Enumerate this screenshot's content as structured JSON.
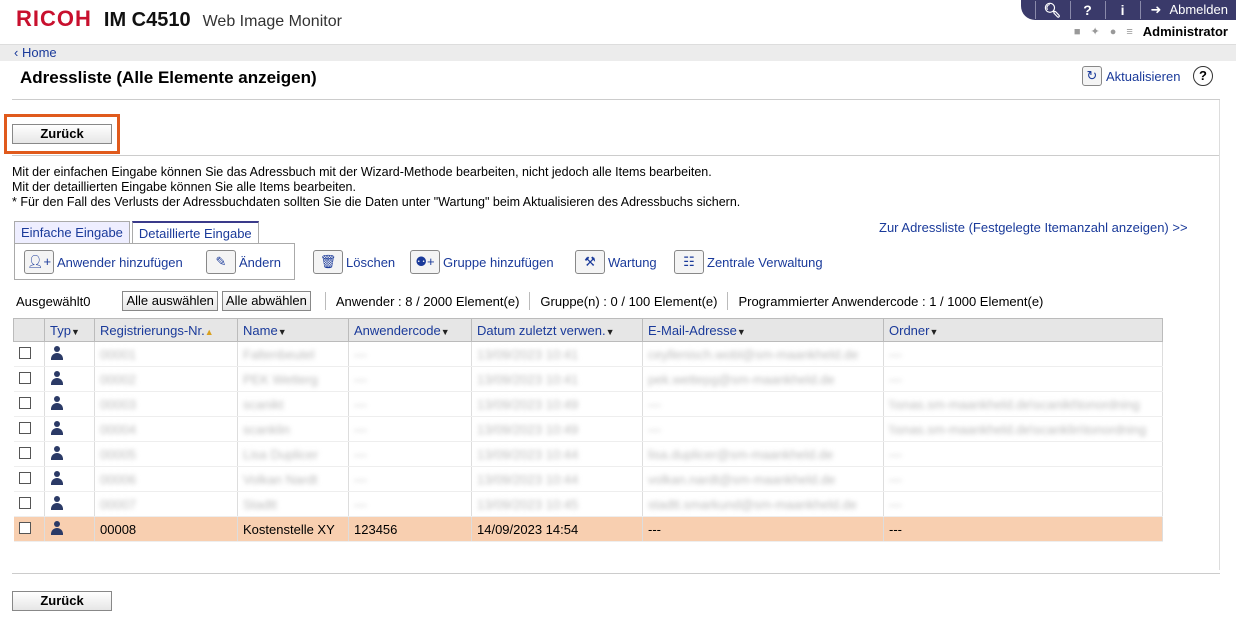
{
  "header": {
    "brand": "RICOH",
    "model": "IM C4510",
    "app": "Web Image Monitor",
    "logout": "Abmelden",
    "user": "Administrator",
    "search_icon": "search-icon",
    "help_icon": "?",
    "info_icon": "i"
  },
  "breadcrumb": {
    "home": "Home"
  },
  "page": {
    "title": "Adressliste (Alle Elemente anzeigen)",
    "refresh": "Aktualisieren",
    "back": "Zurück"
  },
  "info": {
    "line1": "Mit der einfachen Eingabe können Sie das Adressbuch mit der Wizard-Methode bearbeiten, nicht jedoch alle Items bearbeiten.",
    "line2": "Mit der detaillierten Eingabe können Sie alle Items bearbeiten.",
    "line3": "* Für den Fall des Verlusts der Adressbuchdaten sollten Sie die Daten unter \"Wartung\" beim Aktualisieren des Adressbuchs sichern."
  },
  "tabs": [
    "Einfache Eingabe",
    "Detaillierte Eingabe"
  ],
  "tools": {
    "add_user": "Anwender hinzufügen",
    "edit": "Ändern",
    "delete": "Löschen",
    "add_group": "Gruppe hinzufügen",
    "maintenance": "Wartung",
    "central": "Zentrale Verwaltung"
  },
  "addr_link": "Zur Adressliste (Festgelegte Itemanzahl anzeigen) >>",
  "selection": {
    "selected": "Ausgewählt0",
    "select_all": "Alle auswählen",
    "deselect_all": "Alle abwählen",
    "users": "Anwender : 8 / 2000 Element(e)",
    "groups": "Gruppe(n) : 0 / 100 Element(e)",
    "codes": "Programmierter Anwendercode : 1 / 1000 Element(e)"
  },
  "table": {
    "headers": [
      "Typ",
      "Registrierungs-Nr.",
      "Name",
      "Anwendercode",
      "Datum zuletzt verwen.",
      "E-Mail-Adresse",
      "Ordner"
    ],
    "rows": [
      {
        "reg": "00001",
        "name": "Faltenbeutel",
        "code": "---",
        "date": "13/09/2023 10:41",
        "email": "ceyllenisch.wobl@sm-maankheld.de",
        "folder": "---"
      },
      {
        "reg": "00002",
        "name": "PEK Wetterg",
        "code": "---",
        "date": "13/09/2023 10:41",
        "email": "pek.wettepg@sm-maankheld.de",
        "folder": "---"
      },
      {
        "reg": "00003",
        "name": "scanikt",
        "code": "---",
        "date": "13/09/2023 10:49",
        "email": "---",
        "folder": "\\\\snas.sm-maankheld.de\\scanikt\\tonordning"
      },
      {
        "reg": "00004",
        "name": "scanklin",
        "code": "---",
        "date": "13/09/2023 10:49",
        "email": "---",
        "folder": "\\\\snas.sm-maankheld.de\\scanklin\\tonordning"
      },
      {
        "reg": "00005",
        "name": "Lisa Duplicer",
        "code": "---",
        "date": "13/09/2023 10:44",
        "email": "lisa.duplicer@sm-maankheld.de",
        "folder": "---"
      },
      {
        "reg": "00006",
        "name": "Volkan Nardt",
        "code": "---",
        "date": "13/09/2023 10:44",
        "email": "volkan.nardt@sm-maankheld.de",
        "folder": "---"
      },
      {
        "reg": "00007",
        "name": "Stadtt",
        "code": "---",
        "date": "13/09/2023 10:45",
        "email": "stadtt.smarkund@sm-maankheld.de",
        "folder": "---"
      },
      {
        "reg": "00008",
        "name": "Kostenstelle XY",
        "code": "123456",
        "date": "14/09/2023 14:54",
        "email": "---",
        "folder": "---"
      }
    ]
  }
}
